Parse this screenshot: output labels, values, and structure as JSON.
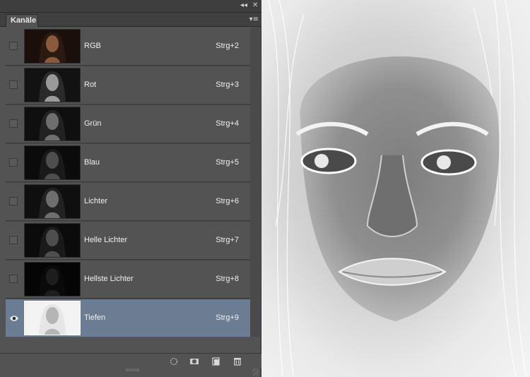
{
  "panel": {
    "tab_label": "Kanäle",
    "collapse_glyph": "◂◂",
    "close_glyph": "✕",
    "menu_glyph": "▾≡",
    "channels": [
      {
        "name": "RGB",
        "shortcut": "Strg+2",
        "visible": false,
        "selected": false,
        "thumb": "color-portrait"
      },
      {
        "name": "Rot",
        "shortcut": "Strg+3",
        "visible": false,
        "selected": false,
        "thumb": "grayscale-bright"
      },
      {
        "name": "Grün",
        "shortcut": "Strg+4",
        "visible": false,
        "selected": false,
        "thumb": "grayscale-mid"
      },
      {
        "name": "Blau",
        "shortcut": "Strg+5",
        "visible": false,
        "selected": false,
        "thumb": "grayscale-dark"
      },
      {
        "name": "Lichter",
        "shortcut": "Strg+6",
        "visible": false,
        "selected": false,
        "thumb": "grayscale-mid"
      },
      {
        "name": "Helle Lichter",
        "shortcut": "Strg+7",
        "visible": false,
        "selected": false,
        "thumb": "grayscale-dark"
      },
      {
        "name": "Hellste Lichter",
        "shortcut": "Strg+8",
        "visible": false,
        "selected": false,
        "thumb": "near-black"
      },
      {
        "name": "Tiefen",
        "shortcut": "Strg+9",
        "visible": true,
        "selected": true,
        "thumb": "inverted-white"
      }
    ],
    "footer_icons": [
      "load-selection-icon",
      "save-selection-mask-icon",
      "new-channel-icon",
      "trash-icon"
    ]
  },
  "colors": {
    "panel_bg": "#535353",
    "selected_row": "#6b7c93",
    "text": "#f0f0f0"
  }
}
